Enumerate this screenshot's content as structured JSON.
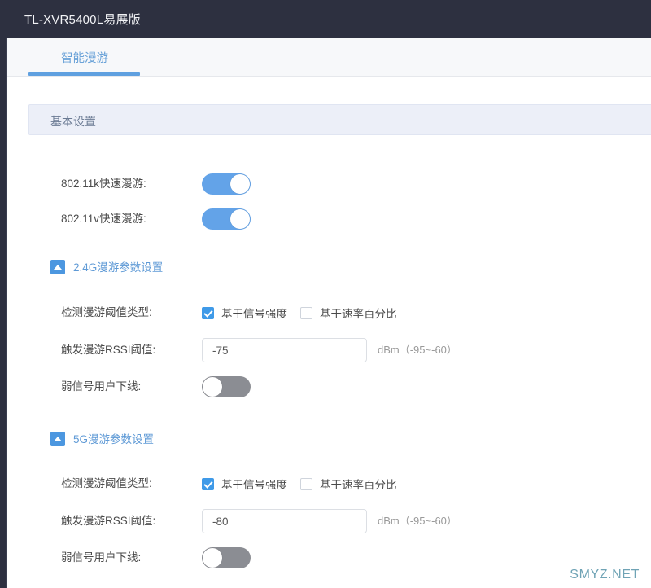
{
  "window": {
    "title": "TL-XVR5400L易展版",
    "title_bar_color": "#2d3040"
  },
  "tabs": [
    {
      "label": "智能漫游",
      "active": true
    }
  ],
  "panel": {
    "header": "基本设置",
    "header_bg": "#eceff8",
    "accent_color": "#5fa0e0"
  },
  "basic_settings": {
    "rows": [
      {
        "label": "802.11k快速漫游:",
        "control": "toggle",
        "state": "on"
      },
      {
        "label": "802.11v快速漫游:",
        "control": "toggle",
        "state": "off_placeholder"
      }
    ],
    "toggle_11k_label": "802.11k快速漫游:",
    "toggle_11k_on": "on",
    "toggle_11v_label": "802.11v快速漫游:",
    "toggle_11v_on": "on"
  },
  "groups": [
    {
      "id": "band24",
      "title": "2.4G漫游参数设置",
      "expanded": true,
      "collapse_icon": "caret-up-icon",
      "threshold_type_label": "检测漫游阈值类型:",
      "options": [
        {
          "label": "基于信号强度",
          "checked": true
        },
        {
          "label": "基于速率百分比",
          "checked": false
        }
      ],
      "rssi_label": "触发漫游RSSI阈值:",
      "rssi_value": "-75",
      "rssi_unit": "dBm（-95~-60）",
      "weak_signal_label": "弱信号用户下线:",
      "weak_signal_on": false
    },
    {
      "id": "band5",
      "title": "5G漫游参数设置",
      "expanded": true,
      "collapse_icon": "caret-up-icon",
      "threshold_type_label": "检测漫游阈值类型:",
      "options": [
        {
          "label": "基于信号强度",
          "checked": true
        },
        {
          "label": "基于速率百分比",
          "checked": false
        }
      ],
      "rssi_label": "触发漫游RSSI阈值:",
      "rssi_value": "-80",
      "rssi_unit": "dBm（-95~-60）",
      "weak_signal_label": "弱信号用户下线:",
      "weak_signal_on": false
    }
  ],
  "watermark": {
    "text": "SMYZ.NET",
    "color": "#6fa3b5"
  }
}
